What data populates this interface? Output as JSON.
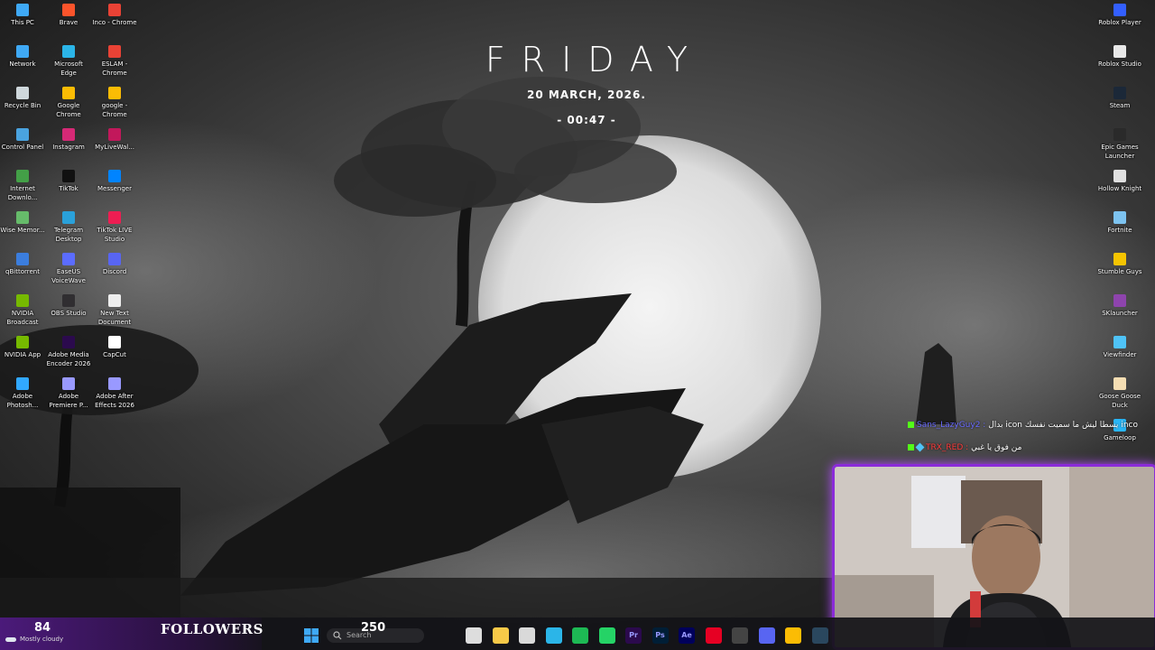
{
  "desktop": {
    "left_icons": [
      {
        "label": "This PC",
        "color": "#3fa9f5"
      },
      {
        "label": "Brave",
        "color": "#fb542b"
      },
      {
        "label": "Inco - Chrome",
        "color": "#e94235"
      },
      {
        "label": "Network",
        "color": "#3fa9f5"
      },
      {
        "label": "Microsoft Edge",
        "color": "#2bb5e8"
      },
      {
        "label": "ESLAM - Chrome",
        "color": "#e94235"
      },
      {
        "label": "Recycle Bin",
        "color": "#cfd8dc"
      },
      {
        "label": "Google Chrome",
        "color": "#fbbc04"
      },
      {
        "label": "google - Chrome",
        "color": "#fbbc04"
      },
      {
        "label": "Control Panel",
        "color": "#4aa3df"
      },
      {
        "label": "Instagram",
        "color": "#d62976"
      },
      {
        "label": "MyLiveWal...",
        "color": "#c2185b"
      },
      {
        "label": "Internet Downlo...",
        "color": "#43a047"
      },
      {
        "label": "TikTok",
        "color": "#111111"
      },
      {
        "label": "Messenger",
        "color": "#0084ff"
      },
      {
        "label": "Wise Memor...",
        "color": "#66bb6a"
      },
      {
        "label": "Telegram Desktop",
        "color": "#2aa1da"
      },
      {
        "label": "TikTok LIVE Studio",
        "color": "#ee1d52"
      },
      {
        "label": "qBittorrent",
        "color": "#3b7ddd"
      },
      {
        "label": "EaseUS VoiceWave",
        "color": "#5b6cff"
      },
      {
        "label": "Discord",
        "color": "#5865f2"
      },
      {
        "label": "NVIDIA Broadcast",
        "color": "#76b900"
      },
      {
        "label": "OBS Studio",
        "color": "#302e31"
      },
      {
        "label": "New Text Document",
        "color": "#eeeeee"
      },
      {
        "label": "NVIDIA App",
        "color": "#76b900"
      },
      {
        "label": "Adobe Media Encoder 2026",
        "color": "#2b0a4d"
      },
      {
        "label": "CapCut",
        "color": "#ffffff"
      },
      {
        "label": "Adobe Photosh...",
        "color": "#31a8ff"
      },
      {
        "label": "Adobe Premiere P...",
        "color": "#9999ff"
      },
      {
        "label": "Adobe After Effects 2026",
        "color": "#9999ff"
      }
    ],
    "right_icons": [
      {
        "label": "Roblox Player",
        "color": "#335fff"
      },
      {
        "label": "Roblox Studio",
        "color": "#e8e8e8"
      },
      {
        "label": "Steam",
        "color": "#1b2838"
      },
      {
        "label": "Epic Games Launcher",
        "color": "#2a2a2a"
      },
      {
        "label": "Hollow Knight",
        "color": "#e0e0e0"
      },
      {
        "label": "Fortnite",
        "color": "#7dc3f0"
      },
      {
        "label": "Stumble Guys",
        "color": "#f5c400"
      },
      {
        "label": "SKlauncher",
        "color": "#8e44ad"
      },
      {
        "label": "Viewfinder",
        "color": "#4fc3f7"
      },
      {
        "label": "Goose Goose Duck",
        "color": "#f5deb3"
      },
      {
        "label": "Gameloop",
        "color": "#29b6f6"
      }
    ]
  },
  "clock_widget": {
    "day": "FRIDAY",
    "date": "20  MARCH, 2026.",
    "time": "- 00:47 -"
  },
  "chat": {
    "messages": [
      {
        "user": "Sans_LazyGuy2 :",
        "text": "بدال icon يسطا ليش ما سميت نفسك inco",
        "user_color": "#6a6cff"
      },
      {
        "user": "TRX_RED :",
        "text": "من فوق يا غبي",
        "user_color": "#ff3b3b"
      }
    ]
  },
  "stream_overlay": {
    "follower_count": "84",
    "followers_label": "FOLLOWERS",
    "follower_goal": "250"
  },
  "taskbar": {
    "weather_text": "Mostly cloudy",
    "search_placeholder": "Search",
    "apps": [
      {
        "name": "task-view",
        "label": "",
        "color": "#dddddd"
      },
      {
        "name": "file-explorer",
        "label": "",
        "color": "#f7c948"
      },
      {
        "name": "microsoft-store",
        "label": "",
        "color": "#d9d9d9"
      },
      {
        "name": "edge",
        "label": "",
        "color": "#2bb5e8"
      },
      {
        "name": "spotify",
        "label": "",
        "color": "#1db954"
      },
      {
        "name": "whatsapp",
        "label": "",
        "color": "#25d366"
      },
      {
        "name": "premiere-pro",
        "label": "Pr",
        "color": "#2b0a4d"
      },
      {
        "name": "photoshop",
        "label": "Ps",
        "color": "#001e36"
      },
      {
        "name": "after-effects",
        "label": "Ae",
        "color": "#00005b"
      },
      {
        "name": "pinterest",
        "label": "",
        "color": "#e60023"
      },
      {
        "name": "obs",
        "label": "",
        "color": "#444444"
      },
      {
        "name": "discord",
        "label": "",
        "color": "#5865f2"
      },
      {
        "name": "chrome",
        "label": "",
        "color": "#fbbc04"
      },
      {
        "name": "steam",
        "label": "",
        "color": "#2a475e"
      }
    ]
  },
  "colors": {
    "overlay_purple": "#8b2bd9",
    "followers_bar": "#4b1a7a"
  }
}
